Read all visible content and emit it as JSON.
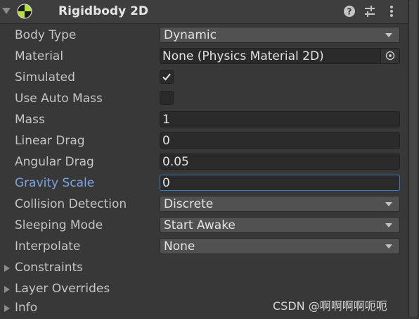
{
  "component": {
    "title": "Rigidbody 2D",
    "icon": "rigidbody-2d-icon",
    "header_buttons": [
      "help-icon",
      "preset-sliders-icon",
      "more-vertical-icon"
    ]
  },
  "fields": {
    "body_type": {
      "label": "Body Type",
      "value": "Dynamic"
    },
    "material": {
      "label": "Material",
      "value": "None (Physics Material 2D)"
    },
    "simulated": {
      "label": "Simulated",
      "checked": true
    },
    "use_auto_mass": {
      "label": "Use Auto Mass",
      "checked": false
    },
    "mass": {
      "label": "Mass",
      "value": "1"
    },
    "linear_drag": {
      "label": "Linear Drag",
      "value": "0"
    },
    "angular_drag": {
      "label": "Angular Drag",
      "value": "0.05"
    },
    "gravity_scale": {
      "label": "Gravity Scale",
      "value": "0"
    },
    "collision_detection": {
      "label": "Collision Detection",
      "value": "Discrete"
    },
    "sleeping_mode": {
      "label": "Sleeping Mode",
      "value": "Start Awake"
    },
    "interpolate": {
      "label": "Interpolate",
      "value": "None"
    }
  },
  "foldouts": {
    "constraints": "Constraints",
    "layer_overrides": "Layer Overrides",
    "info": "Info"
  },
  "watermark": "CSDN @啊啊啊啊呃呃",
  "colors": {
    "background": "#383838",
    "focus_accent": "#3a79bb",
    "highlight_label": "#7ba4e0"
  }
}
